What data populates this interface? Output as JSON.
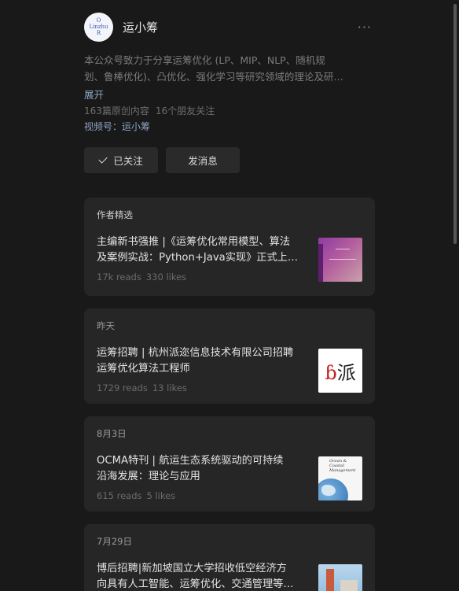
{
  "account": {
    "avatar_text": [
      "O",
      "Linzhu",
      "R"
    ],
    "name": "运小筹",
    "more_icon": "···",
    "description_lines": [
      "本公众号致力于分享运筹优化 (LP、MIP、NLP、随机规",
      "划、鲁棒优化)、凸优化、强化学习等研究领域的理论及研…"
    ],
    "expand_label": "展开",
    "original_count": "163篇原创内容",
    "friends_following": "16个朋友关注",
    "channel_label": "视频号：运小筹"
  },
  "buttons": {
    "followed_label": "已关注",
    "message_label": "发消息"
  },
  "articles": [
    {
      "label": "作者精选",
      "title_lines": [
        "主编新书强推 |《运筹优化常用模型、算法",
        "及案例实战：Python+Java实现》正式上…"
      ],
      "reads": "17k reads",
      "likes": "330 likes",
      "thumb": "book"
    },
    {
      "label": "昨天",
      "title_lines": [
        "运筹招聘 | 杭州派迩信息技术有限公司招聘",
        "运筹优化算法工程师"
      ],
      "reads": "1729 reads",
      "likes": "13 likes",
      "thumb": "pai",
      "thumb_text_a": "ɓ",
      "thumb_text_b": "派"
    },
    {
      "label": "8月3日",
      "title_lines": [
        "OCMA特刊 | 航运生态系统驱动的可持续",
        "沿海发展：理论与应用"
      ],
      "reads": "615 reads",
      "likes": "5 likes",
      "thumb": "journal",
      "thumb_text": "Ocean & Coastal Management"
    },
    {
      "label": "7月29日",
      "title_lines": [
        "博后招聘|新加坡国立大学招收低空经济方",
        "向具有人工智能、运筹优化、交通管理等…"
      ],
      "reads": "",
      "likes": "",
      "thumb": "nus"
    }
  ],
  "colors": {
    "background": "#191919",
    "card": "#262626",
    "link": "#8ea3c5"
  }
}
